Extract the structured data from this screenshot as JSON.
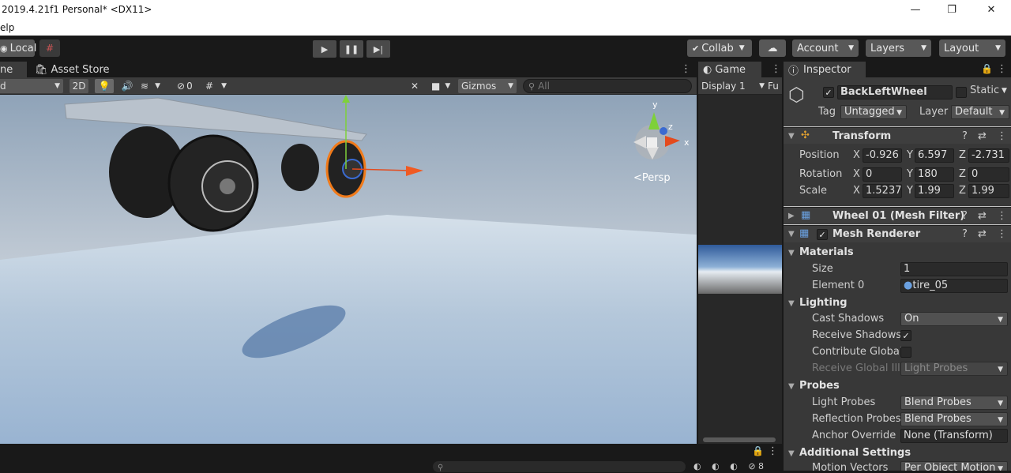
{
  "window": {
    "title": "2019.4.21f1 Personal* <DX11>",
    "menu": "elp"
  },
  "toolbar": {
    "pivot": "Local",
    "collab": "Collab",
    "account": "Account",
    "layers": "Layers",
    "layout": "Layout"
  },
  "tabs": {
    "scene": "ne",
    "asset_store": "Asset Store",
    "game": "Game",
    "inspector": "Inspector"
  },
  "scenebar": {
    "mode": "d",
    "two_d": "2D",
    "gizmos": "Gizmos",
    "search_placeholder": "All",
    "hidden_count": "0"
  },
  "game": {
    "display": "Display 1",
    "scale": "Fu"
  },
  "scene": {
    "persp": "Persp",
    "gizmo_y": "y",
    "gizmo_z": "z",
    "gizmo_x": "x"
  },
  "inspector": {
    "name": "BackLeftWheel",
    "static": "Static",
    "tag_label": "Tag",
    "tag": "Untagged",
    "layer_label": "Layer",
    "layer": "Default",
    "transform": {
      "title": "Transform",
      "position": {
        "label": "Position",
        "x": "-0.926",
        "y": "6.597",
        "z": "-2.731"
      },
      "rotation": {
        "label": "Rotation",
        "x": "0",
        "y": "180",
        "z": "0"
      },
      "scale": {
        "label": "Scale",
        "x": "1.5237",
        "y": "1.99",
        "z": "1.99"
      },
      "axis_x": "X",
      "axis_y": "Y",
      "axis_z": "Z"
    },
    "mesh_filter": "Wheel 01 (Mesh Filter)",
    "mesh_renderer": "Mesh Renderer",
    "materials": {
      "title": "Materials",
      "size_label": "Size",
      "size": "1",
      "element0_label": "Element 0",
      "element0": "tire_05"
    },
    "lighting": {
      "title": "Lighting",
      "cast_label": "Cast Shadows",
      "cast": "On",
      "receive_label": "Receive Shadows",
      "contrib_label": "Contribute Global",
      "rgi_label": "Receive Global Illu",
      "rgi": "Light Probes"
    },
    "probes": {
      "title": "Probes",
      "light_label": "Light Probes",
      "light": "Blend Probes",
      "refl_label": "Reflection Probes",
      "refl": "Blend Probes",
      "anchor_label": "Anchor Override",
      "anchor": "None (Transform)"
    },
    "additional": {
      "title": "Additional Settings",
      "motion_label": "Motion Vectors",
      "motion": "Per Object Motion"
    }
  },
  "bottom": {
    "count": "8"
  }
}
